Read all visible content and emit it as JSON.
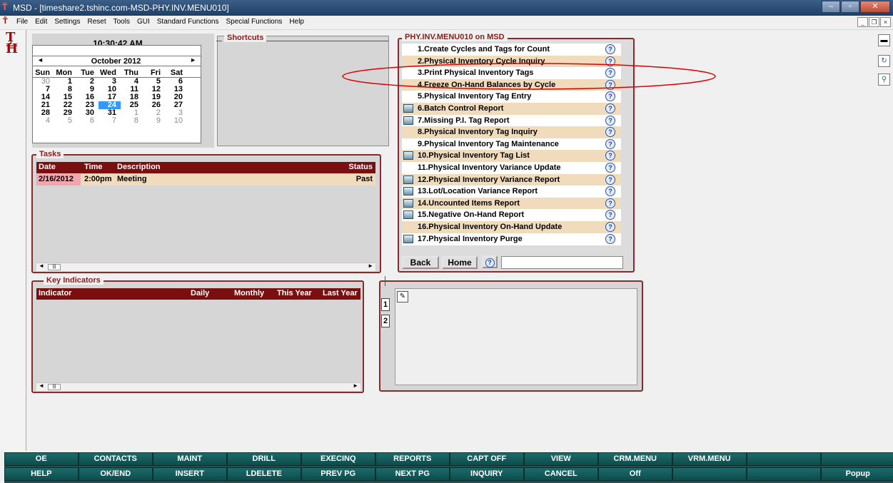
{
  "window": {
    "title": "MSD - [timeshare2.tshinc.com-MSD-PHY.INV.MENU010]"
  },
  "menubar": [
    "File",
    "Edit",
    "Settings",
    "Reset",
    "Tools",
    "GUI",
    "Standard Functions",
    "Special Functions",
    "Help"
  ],
  "clock": "10:30:42 AM",
  "calendar": {
    "month": "October 2012",
    "days_header": [
      "Sun",
      "Mon",
      "Tue",
      "Wed",
      "Thu",
      "Fri",
      "Sat"
    ],
    "weeks": [
      [
        "30",
        "1",
        "2",
        "3",
        "4",
        "5",
        "6"
      ],
      [
        "7",
        "8",
        "9",
        "10",
        "11",
        "12",
        "13"
      ],
      [
        "14",
        "15",
        "16",
        "17",
        "18",
        "19",
        "20"
      ],
      [
        "21",
        "22",
        "23",
        "24",
        "25",
        "26",
        "27"
      ],
      [
        "28",
        "29",
        "30",
        "31",
        "1",
        "2",
        "3"
      ],
      [
        "4",
        "5",
        "6",
        "7",
        "8",
        "9",
        "10"
      ]
    ],
    "selected": "24"
  },
  "shortcuts": {
    "title": "Shortcuts"
  },
  "menu": {
    "title": "PHY.INV.MENU010 on MSD",
    "items": [
      {
        "label": "1.Create Cycles and Tags for Count",
        "icon": false
      },
      {
        "label": "2.Physical Inventory Cycle Inquiry",
        "icon": false
      },
      {
        "label": "3.Print Physical Inventory Tags",
        "icon": false
      },
      {
        "label": "4.Freeze On-Hand Balances by Cycle",
        "icon": false
      },
      {
        "label": "5.Physical Inventory Tag Entry",
        "icon": false
      },
      {
        "label": "6.Batch Control Report",
        "icon": true
      },
      {
        "label": "7.Missing P.I. Tag Report",
        "icon": true
      },
      {
        "label": "8.Physical Inventory Tag Inquiry",
        "icon": false
      },
      {
        "label": "9.Physical Inventory Tag Maintenance",
        "icon": false
      },
      {
        "label": "10.Physical Inventory Tag List",
        "icon": true
      },
      {
        "label": "11.Physical Inventory Variance Update",
        "icon": false
      },
      {
        "label": "12.Physical Inventory Variance Report",
        "icon": true
      },
      {
        "label": "13.Lot/Location Variance Report",
        "icon": true
      },
      {
        "label": "14.Uncounted Items Report",
        "icon": true
      },
      {
        "label": "15.Negative On-Hand Report",
        "icon": true
      },
      {
        "label": "16.Physical Inventory On-Hand Update",
        "icon": false
      },
      {
        "label": "17.Physical Inventory Purge",
        "icon": true
      }
    ],
    "back_label": "Back",
    "home_label": "Home",
    "command_value": ""
  },
  "tasks": {
    "title": "Tasks",
    "columns": [
      "Date",
      "Time",
      "Description",
      "Status"
    ],
    "rows": [
      {
        "date": "2/16/2012",
        "time": "2:00pm",
        "description": "Meeting",
        "status": "Past"
      }
    ]
  },
  "key_indicators": {
    "title": "Key Indicators",
    "columns": [
      "Indicator",
      "Daily",
      "Monthly",
      "This Year",
      "Last Year"
    ]
  },
  "side_tabs": [
    "1",
    "2"
  ],
  "function_keys": {
    "row1": [
      "OE",
      "CONTACTS",
      "MAINT",
      "DRILL",
      "EXECINQ",
      "REPORTS",
      "CAPT OFF",
      "VIEW",
      "CRM.MENU",
      "VRM.MENU",
      "",
      ""
    ],
    "row2": [
      "HELP",
      "OK/END",
      "INSERT",
      "LDELETE",
      "PREV PG",
      "NEXT PG",
      "INQUIRY",
      "CANCEL",
      "Off",
      "",
      "",
      "Popup"
    ]
  },
  "colors": {
    "header_red": "#7a0f0f",
    "alt_row": "#f0dcbd",
    "selected_day": "#3399ff",
    "fkey_teal": "#0d4c4c",
    "annotation": "#e00000"
  }
}
